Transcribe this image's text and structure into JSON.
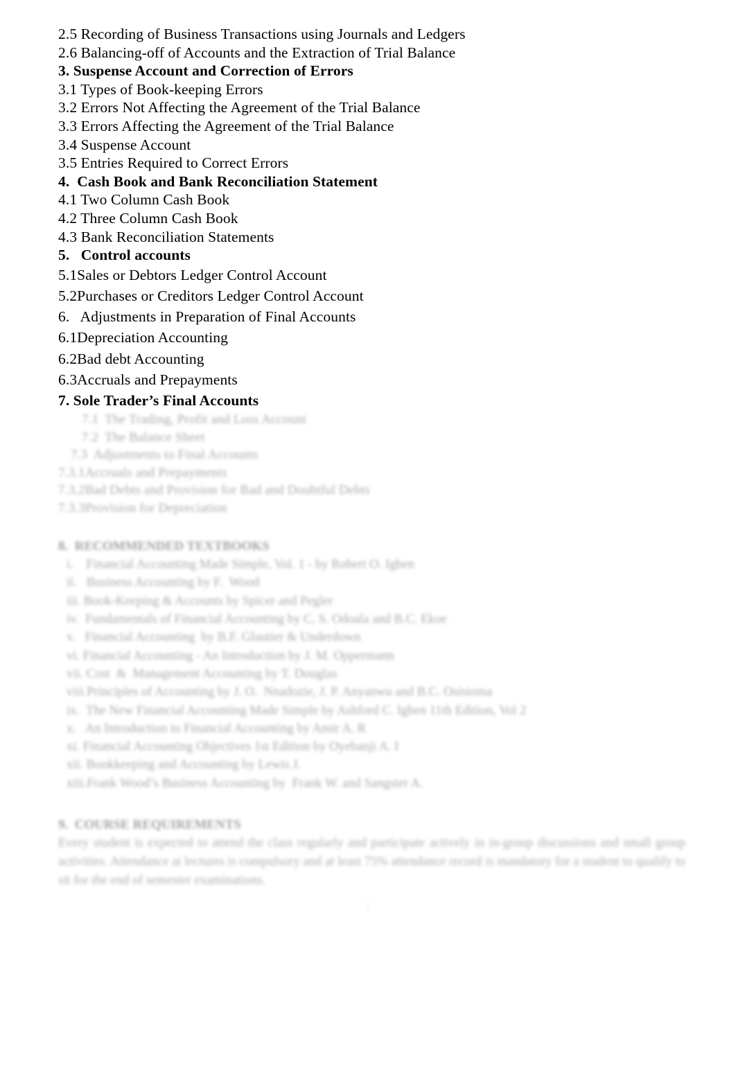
{
  "document": {
    "type": "course-outline",
    "page_number": "2",
    "text_color": "#000000",
    "faded_text_color": "#8d8d8d",
    "background_color": "#ffffff"
  },
  "outline": {
    "crisp_lines": [
      {
        "text": "2.5 Recording of Business Transactions using Journals and Ledgers",
        "bold": false,
        "loose": false
      },
      {
        "text": "2.6 Balancing-off of Accounts and the Extraction of Trial Balance",
        "bold": false,
        "loose": false
      },
      {
        "text": "3. Suspense Account and Correction of Errors",
        "bold": true,
        "loose": false
      },
      {
        "text": "3.1 Types of Book-keeping Errors",
        "bold": false,
        "loose": false
      },
      {
        "text": "3.2 Errors Not Affecting the Agreement of the Trial Balance",
        "bold": false,
        "loose": false
      },
      {
        "text": "3.3 Errors Affecting the Agreement of the Trial Balance",
        "bold": false,
        "loose": false
      },
      {
        "text": "3.4 Suspense Account",
        "bold": false,
        "loose": false
      },
      {
        "text": "3.5 Entries Required to Correct Errors",
        "bold": false,
        "loose": false
      },
      {
        "text": "4.  Cash Book and Bank Reconciliation Statement",
        "bold": true,
        "loose": false
      },
      {
        "text": "4.1 Two Column Cash Book",
        "bold": false,
        "loose": false
      },
      {
        "text": "4.2 Three Column Cash Book",
        "bold": false,
        "loose": false
      },
      {
        "text": "4.3 Bank Reconciliation Statements",
        "bold": false,
        "loose": false
      },
      {
        "text": "5.   Control accounts",
        "bold": true,
        "loose": false
      },
      {
        "text": "5.1Sales or Debtors Ledger Control Account",
        "bold": false,
        "loose": true
      },
      {
        "text": "5.2Purchases or Creditors Ledger Control Account",
        "bold": false,
        "loose": true
      },
      {
        "text": "6.   Adjustments in Preparation of Final Accounts",
        "bold": false,
        "loose": true
      },
      {
        "text": "6.1Depreciation Accounting",
        "bold": false,
        "loose": true
      },
      {
        "text": "6.2Bad debt Accounting",
        "bold": false,
        "loose": true
      },
      {
        "text": "6.3Accruals and Prepayments",
        "bold": false,
        "loose": true
      },
      {
        "text": "7. Sole Trader’s Final Accounts",
        "bold": true,
        "loose": true
      }
    ],
    "faded_lines": [
      {
        "text": "7.1  The Trading, Profit and Loss Account",
        "indent": 1
      },
      {
        "text": "7.2  The Balance Sheet",
        "indent": 1
      },
      {
        "text": "7.3  Adjustments to Final Accounts",
        "indent": 2
      },
      {
        "text": "7.3.1Accruals and Prepayments",
        "indent": 0
      },
      {
        "text": "7.3.2Bad Debts and Provision for Bad and Doubtful Debts",
        "indent": 0
      },
      {
        "text": "7.3.3Provision for Depreciation",
        "indent": 0
      }
    ]
  },
  "textbooks": {
    "heading": "8.  RECOMMENDED TEXTBOOKS",
    "items": [
      "i.    Financial Accounting Made Simple, Vol. 1 - by Robert O. Igben",
      "ii.   Business Accounting by F.  Wood",
      "iii. Book-Keeping & Accounts by Spicer and Pegler",
      "iv.  Fundamentals of Financial Accounting by C. S. Odoala and B.C. Ekoe",
      "v.   Financial Accounting  by B.F. Glautier & Underdown",
      "vi. Financial Accounting - An Introduction by J. M. Oppermann",
      "vii. Cost  &  Management Accounting by T. Douglas",
      "viii.Principles of Accounting by J. O.  Nnadozie, J. P. Anyanwu and B.C. Osisioma",
      "ix.  The New Financial Accounting Made Simple by Ashford C. Igben 11th Edition, Vol 2",
      "x.   An Introduction to Financial Accounting by Amir A. R",
      "xi. Financial Accounting Objectives 1st Edition by Oyebanji A. I",
      "xii. Bookkeeping and Accounting by Lewis J.",
      "xiii.Frank Wood’s Business Accounting by  Frank W. and Sangster A."
    ]
  },
  "requirements": {
    "heading": "9.  COURSE REQUIREMENTS",
    "paragraph": "Every student is expected to attend the class regularly and participate actively in in-group discussions and small group activities. Attendance at lectures is compulsory and at least 75% attendance record is mandatory for a student to qualify to sit for the end of semester examinations."
  }
}
